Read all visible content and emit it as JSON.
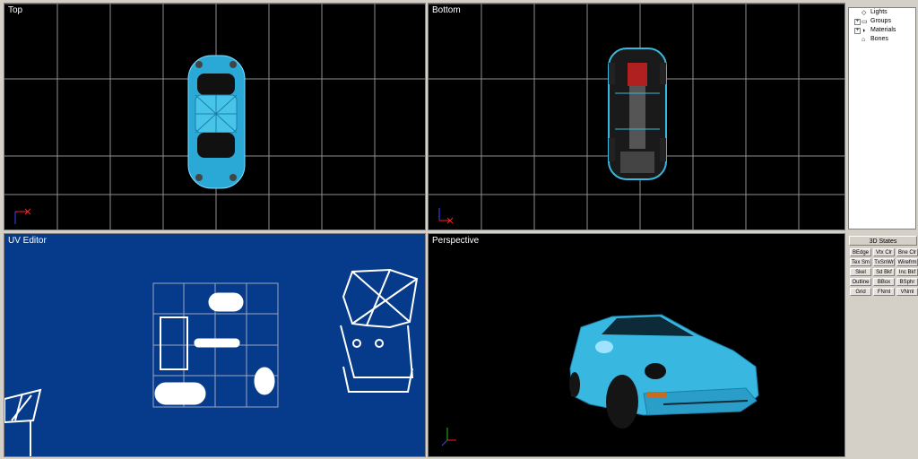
{
  "viewports": {
    "top": {
      "label": "Top"
    },
    "bottom": {
      "label": "Bottom"
    },
    "uv": {
      "label": "UV Editor"
    },
    "perspective": {
      "label": "Perspective"
    }
  },
  "scene_tree": {
    "items": [
      {
        "label": "Lights",
        "expander": "",
        "icon": "light-icon"
      },
      {
        "label": "Groups",
        "expander": "+",
        "icon": "group-icon"
      },
      {
        "label": "Materials",
        "expander": "+",
        "icon": "material-icon"
      },
      {
        "label": "Bones",
        "expander": "",
        "icon": "bone-icon"
      }
    ]
  },
  "states_panel": {
    "title": "3D States",
    "buttons": [
      "BEdge",
      "Vtx Clr",
      "Bne Clr",
      "Tex Sm",
      "TxSnWr",
      "Wirefrm",
      "Skel",
      "Sd Bkf",
      "Inc Bkf",
      "Outline",
      "BBox",
      "BSphr",
      "Grid",
      "FNml",
      "VNml"
    ]
  },
  "colors": {
    "viewport_bg": "#000000",
    "uv_bg": "#063b8c",
    "grid_line": "#a0a0a0",
    "car_body": "#38b8e0",
    "panel_bg": "#d4d0c8",
    "axis_x": "#ff2020",
    "axis_y": "#20c020",
    "axis_z": "#4040ff"
  }
}
